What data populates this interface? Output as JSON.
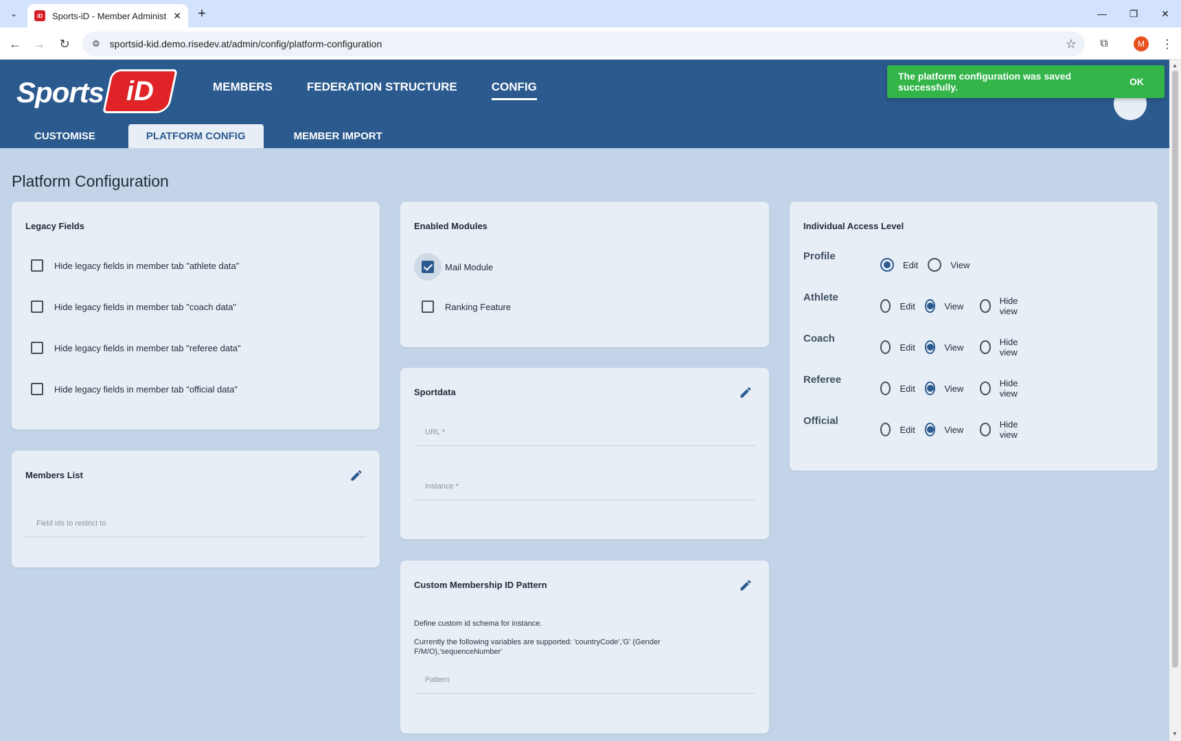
{
  "browser": {
    "tab_title": "Sports-iD - Member Administra",
    "url": "sportsid-kid.demo.risedev.at/admin/config/platform-configuration",
    "profile_initial": "M"
  },
  "header": {
    "logo_text": "Sports",
    "logo_badge": "iD",
    "nav": [
      {
        "label": "MEMBERS"
      },
      {
        "label": "FEDERATION STRUCTURE"
      },
      {
        "label": "CONFIG"
      }
    ],
    "subnav": [
      {
        "label": "CUSTOMISE"
      },
      {
        "label": "PLATFORM CONFIG"
      },
      {
        "label": "MEMBER IMPORT"
      }
    ]
  },
  "toast": {
    "message": "The platform configuration was saved successfully.",
    "ok_label": "OK",
    "color": "#33b54a"
  },
  "page": {
    "title": "Platform Configuration"
  },
  "legacy_fields": {
    "title": "Legacy Fields",
    "items": [
      {
        "label": "Hide legacy fields in member tab \"athlete data\"",
        "checked": false
      },
      {
        "label": "Hide legacy fields in member tab \"coach data\"",
        "checked": false
      },
      {
        "label": "Hide legacy fields in member tab \"referee data\"",
        "checked": false
      },
      {
        "label": "Hide legacy fields in member tab \"official data\"",
        "checked": false
      }
    ]
  },
  "members_list": {
    "title": "Members List",
    "field_label": "Field ids to restrict to"
  },
  "enabled_modules": {
    "title": "Enabled Modules",
    "items": [
      {
        "label": "Mail Module",
        "checked": true
      },
      {
        "label": "Ranking Feature",
        "checked": false
      }
    ]
  },
  "sportdata": {
    "title": "Sportdata",
    "url_label": "URL *",
    "instance_label": "Instance *"
  },
  "custom_id": {
    "title": "Custom Membership ID Pattern",
    "desc1": "Define custom id schema for instance.",
    "desc2": "Currently the following variables are supported: 'countryCode','G' (Gender F/M/O),'sequenceNumber'",
    "pattern_label": "Pattern"
  },
  "access_level": {
    "title": "Individual Access Level",
    "edit_label": "Edit",
    "view_label": "View",
    "hide_label": "Hide view",
    "rows": [
      {
        "name": "Profile",
        "selected": "edit"
      },
      {
        "name": "Athlete",
        "selected": "view"
      },
      {
        "name": "Coach",
        "selected": "view"
      },
      {
        "name": "Referee",
        "selected": "view"
      },
      {
        "name": "Official",
        "selected": "view"
      }
    ]
  },
  "colors": {
    "header_blue": "#2b5a8e",
    "page_bg": "#c3d4e8",
    "card_bg": "#e8eef6"
  }
}
